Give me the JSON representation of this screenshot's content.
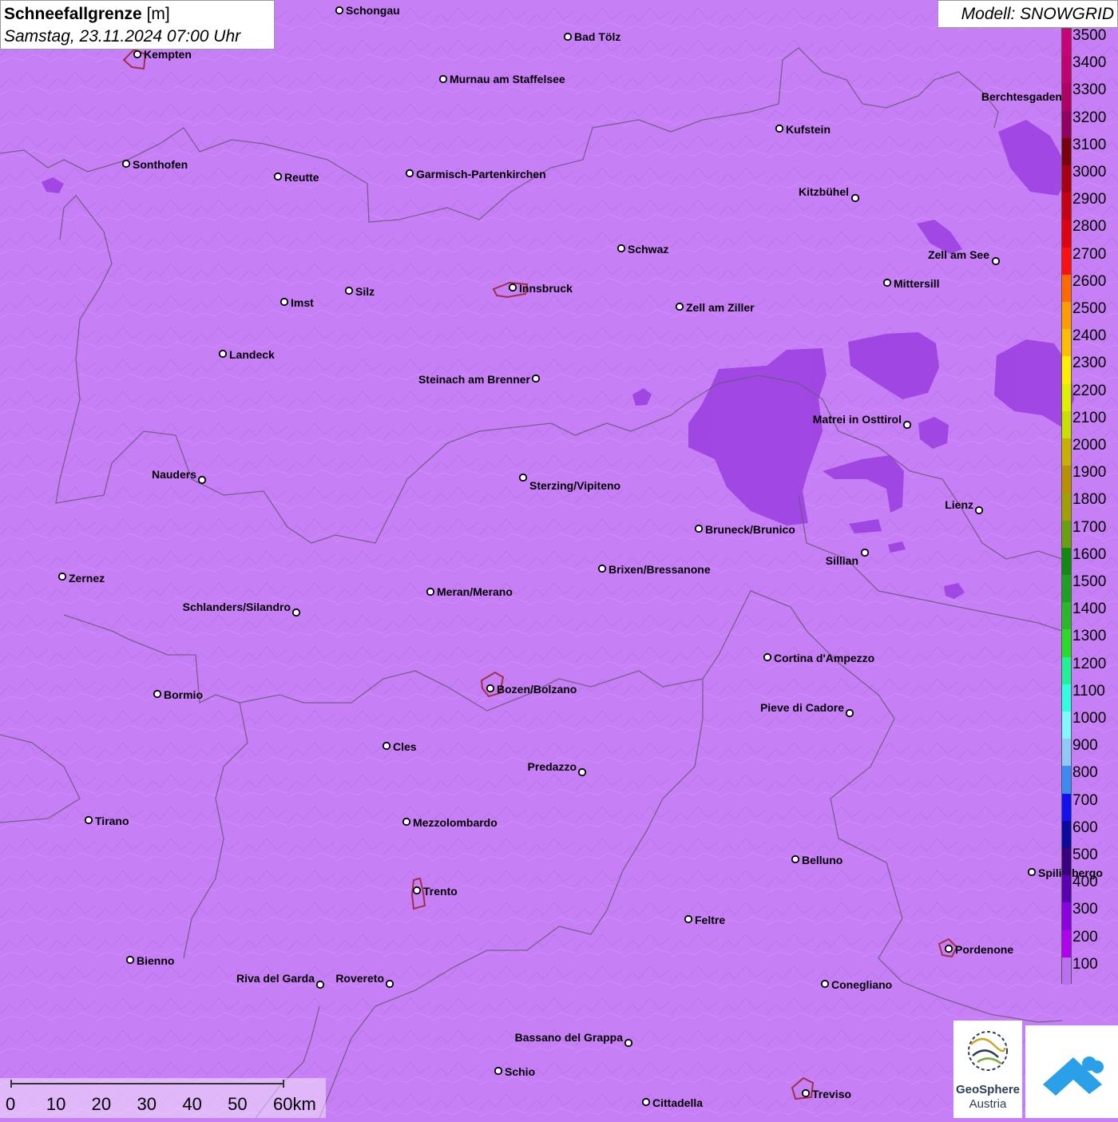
{
  "header": {
    "title_main": "Schneefallgrenze",
    "title_unit": "[m]",
    "date": "Samstag, 23.11.2024 07:00 Uhr",
    "model": "Modell: SNOWGRID"
  },
  "legend": {
    "values": [
      "3500",
      "3400",
      "3300",
      "3200",
      "3100",
      "3000",
      "2900",
      "2800",
      "2700",
      "2600",
      "2500",
      "2400",
      "2300",
      "2200",
      "2100",
      "2000",
      "1900",
      "1800",
      "1700",
      "1600",
      "1500",
      "1400",
      "1300",
      "1200",
      "1100",
      "1000",
      "900",
      "800",
      "700",
      "600",
      "500",
      "400",
      "300",
      "200",
      "100"
    ],
    "colors": [
      "#cc0077",
      "#c20070",
      "#b00066",
      "#940060",
      "#7a0010",
      "#a80012",
      "#c8000f",
      "#e00010",
      "#ff1010",
      "#ff6a00",
      "#ff9c00",
      "#ffbe00",
      "#ffee00",
      "#ddf000",
      "#c8e000",
      "#c8b000",
      "#b89000",
      "#a0a000",
      "#6aa010",
      "#108a10",
      "#20a020",
      "#28b828",
      "#28dc28",
      "#20f098",
      "#30ffe0",
      "#80f8ff",
      "#90c8f8",
      "#3a8cf0",
      "#1010f0",
      "#0a0aa0",
      "#3a0080",
      "#5a00b0",
      "#8a00e0",
      "#b000f0",
      "#b870f0"
    ]
  },
  "cities": [
    {
      "name": "Schongau",
      "side": "right"
    },
    {
      "name": "Bad Tölz",
      "side": "right"
    },
    {
      "name": "Kempten",
      "side": "right"
    },
    {
      "name": "Murnau am Staffelsee",
      "side": "right"
    },
    {
      "name": "Berchtesgaden",
      "side": "left"
    },
    {
      "name": "Kufstein",
      "side": "right"
    },
    {
      "name": "Sonthofen",
      "side": "right"
    },
    {
      "name": "Reutte",
      "side": "right"
    },
    {
      "name": "Garmisch-Partenkirchen",
      "side": "right"
    },
    {
      "name": "Kitzbühel",
      "side": "left"
    },
    {
      "name": "Schwaz",
      "side": "right"
    },
    {
      "name": "Zell am See",
      "side": "left"
    },
    {
      "name": "Innsbruck",
      "side": "right"
    },
    {
      "name": "Mittersill",
      "side": "right"
    },
    {
      "name": "Silz",
      "side": "right"
    },
    {
      "name": "Imst",
      "side": "right"
    },
    {
      "name": "Zell am Ziller",
      "side": "right"
    },
    {
      "name": "Landeck",
      "side": "right"
    },
    {
      "name": "Steinach am Brenner",
      "side": "left"
    },
    {
      "name": "Matrei in Osttirol",
      "side": "left"
    },
    {
      "name": "Nauders",
      "side": "left"
    },
    {
      "name": "Sterzing/Vipiteno",
      "side": "right"
    },
    {
      "name": "Lienz",
      "side": "left"
    },
    {
      "name": "Bruneck/Brunico",
      "side": "right"
    },
    {
      "name": "Sillian",
      "side": "left"
    },
    {
      "name": "Brixen/Bressanone",
      "side": "right"
    },
    {
      "name": "Zernez",
      "side": "right"
    },
    {
      "name": "Meran/Merano",
      "side": "right"
    },
    {
      "name": "Schlanders/Silandro",
      "side": "left"
    },
    {
      "name": "Cortina d'Ampezzo",
      "side": "right"
    },
    {
      "name": "Bozen/Bolzano",
      "side": "right"
    },
    {
      "name": "Bormio",
      "side": "right"
    },
    {
      "name": "Pieve di Cadore",
      "side": "left"
    },
    {
      "name": "Cles",
      "side": "right"
    },
    {
      "name": "Predazzo",
      "side": "left"
    },
    {
      "name": "Tirano",
      "side": "right"
    },
    {
      "name": "Mezzolombardo",
      "side": "right"
    },
    {
      "name": "Belluno",
      "side": "right"
    },
    {
      "name": "Spilimbergo",
      "side": "right"
    },
    {
      "name": "Trento",
      "side": "right"
    },
    {
      "name": "Feltre",
      "side": "right"
    },
    {
      "name": "Pordenone",
      "side": "right"
    },
    {
      "name": "Bienno",
      "side": "right"
    },
    {
      "name": "Riva del Garda",
      "side": "left"
    },
    {
      "name": "Rovereto",
      "side": "left"
    },
    {
      "name": "Conegliano",
      "side": "right"
    },
    {
      "name": "Bassano del Grappa",
      "side": "left"
    },
    {
      "name": "Schio",
      "side": "right"
    },
    {
      "name": "Cittadella",
      "side": "right"
    },
    {
      "name": "Treviso",
      "side": "right"
    }
  ],
  "scale_bar": {
    "labels": [
      "0",
      "10",
      "20",
      "30",
      "40",
      "50",
      "60km"
    ]
  },
  "logos": {
    "geosphere_line1": "GeoSphere",
    "geosphere_line2": "Austria"
  }
}
